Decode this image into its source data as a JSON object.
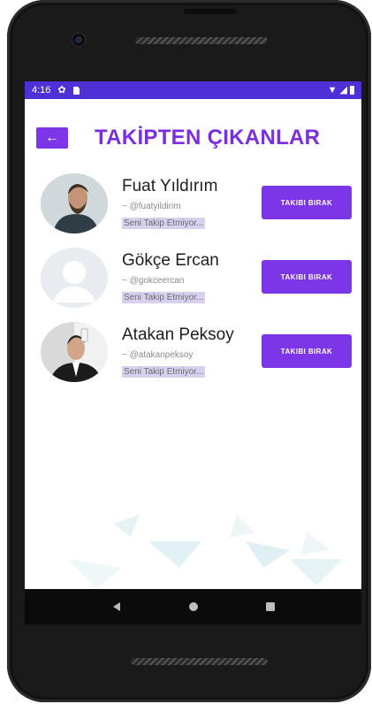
{
  "status_bar": {
    "time": "4:16",
    "icons": [
      "gear-icon",
      "sd-card-icon",
      "wifi-icon",
      "signal-icon",
      "battery-icon"
    ]
  },
  "header": {
    "back_icon": "arrow-left-icon",
    "back_glyph": "←",
    "title": "TAKİPTEN ÇIKANLAR"
  },
  "users": [
    {
      "name": "Fuat Yıldırım",
      "handle": "~ @fuatyildirim",
      "status": "Seni Takip Etmiyor...",
      "button": "TAKIBI BIRAK",
      "avatar": "photo-man-bearded"
    },
    {
      "name": "Gökçe Ercan",
      "handle": "~ @gokceercan",
      "status": "Seni Takip Etmiyor...",
      "button": "TAKIBI BIRAK",
      "avatar": "placeholder-person"
    },
    {
      "name": "Atakan Peksoy",
      "handle": "~ @atakanpeksoy",
      "status": "Seni Takip Etmiyor...",
      "button": "TAKIBI BIRAK",
      "avatar": "photo-man-suit"
    }
  ],
  "nav_bar": {
    "items": [
      "back-triangle-icon",
      "home-circle-icon",
      "recents-square-icon"
    ]
  },
  "colors": {
    "accent": "#7c36e6",
    "status_bar": "#4f2fd6",
    "title": "#7b2ee0",
    "status_pill": "#d8d0ef"
  }
}
